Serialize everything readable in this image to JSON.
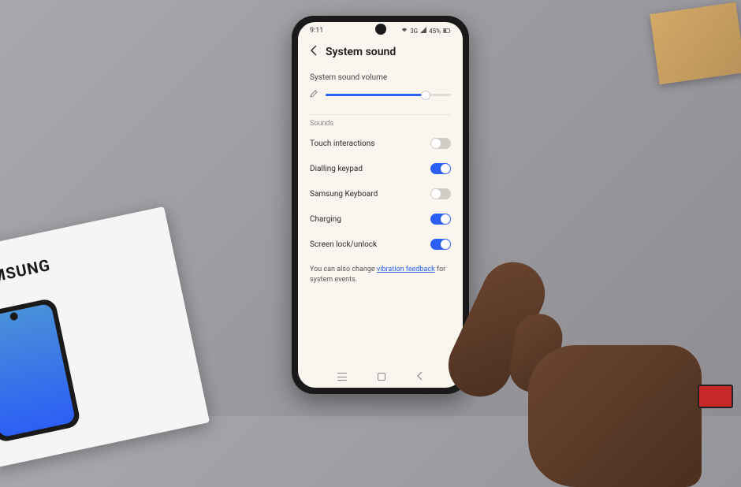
{
  "status": {
    "time": "9:11",
    "battery": "45%",
    "network": "3G"
  },
  "header": {
    "title": "System sound"
  },
  "volume": {
    "label": "System sound volume",
    "percent": 80
  },
  "sections": {
    "sounds_header": "Sounds"
  },
  "toggles": [
    {
      "label": "Touch interactions",
      "value": false
    },
    {
      "label": "Dialling keypad",
      "value": true
    },
    {
      "label": "Samsung Keyboard",
      "value": false
    },
    {
      "label": "Charging",
      "value": true
    },
    {
      "label": "Screen lock/unlock",
      "value": true
    }
  ],
  "footer": {
    "prefix": "You can also change ",
    "link": "vibration feedback",
    "suffix": " for system events."
  },
  "box": {
    "brand": "SAMSUNG"
  }
}
